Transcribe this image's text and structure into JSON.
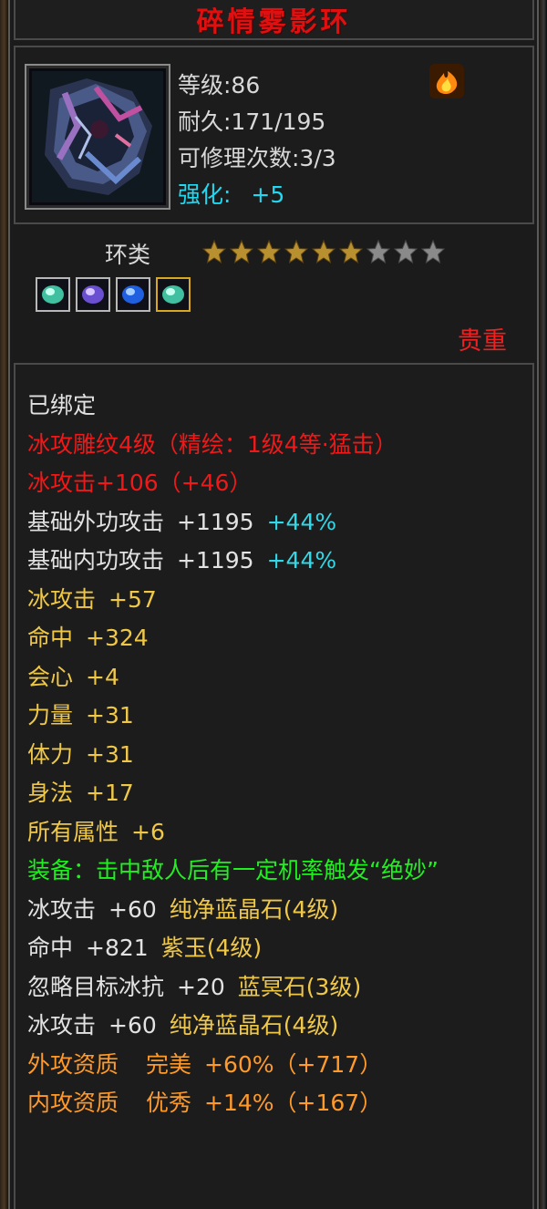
{
  "item": {
    "name": "碎情雾影环",
    "level": "等级:86",
    "durability": "耐久:171/195",
    "repair": "可修理次数:3/3",
    "enhance_label": "强化:",
    "enhance_value": "+5",
    "icon": "flame-icon"
  },
  "category": {
    "type": "环类",
    "stars_filled": 6,
    "stars_total": 9,
    "rarity": "贵重"
  },
  "gems": [
    {
      "icon": "green-gem-icon",
      "border": "#b8b8b8"
    },
    {
      "icon": "purple-gem-icon",
      "border": "#b8b8b8"
    },
    {
      "icon": "blue-gem-icon",
      "border": "#b8b8b8"
    },
    {
      "icon": "green-gem-icon",
      "border": "#d8a820"
    }
  ],
  "attributes": {
    "bound": "已绑定",
    "engrave": "冰攻雕纹4级（精绘：1级4等·猛击）",
    "ice_attack_total": "冰攻击+106（+46）",
    "base_ext": {
      "label": "基础外功攻击",
      "value": "+1195",
      "pct": "+44%"
    },
    "base_int": {
      "label": "基础内功攻击",
      "value": "+1195",
      "pct": "+44%"
    },
    "stats": [
      {
        "label": "冰攻击",
        "value": "+57"
      },
      {
        "label": "命中",
        "value": "+324"
      },
      {
        "label": "会心",
        "value": "+4"
      },
      {
        "label": "力量",
        "value": "+31"
      },
      {
        "label": "体力",
        "value": "+31"
      },
      {
        "label": "身法",
        "value": "+17"
      },
      {
        "label": "所有属性",
        "value": "+6"
      }
    ],
    "equip_effect": "装备：击中敌人后有一定机率触发“绝妙”",
    "gem_lines": [
      {
        "label": "冰攻击",
        "value": "+60",
        "gem": "纯净蓝晶石(4级)"
      },
      {
        "label": "命中",
        "value": "+821",
        "gem": "紫玉(4级)"
      },
      {
        "label": "忽略目标冰抗",
        "value": "+20",
        "gem": "蓝冥石(3级)"
      },
      {
        "label": "冰攻击",
        "value": "+60",
        "gem": "纯净蓝晶石(4级)"
      }
    ],
    "quality_ext": {
      "label": "外攻资质",
      "grade": "完美",
      "value": "+60%（+717）"
    },
    "quality_int": {
      "label": "内攻资质",
      "grade": "优秀",
      "value": "+14%（+167）"
    }
  },
  "colors": {
    "title": "#e01010",
    "red": "#f01818",
    "yellow": "#f0c848",
    "green": "#20f020",
    "orange": "#ff9a2a",
    "cyan": "#30d8e8"
  }
}
